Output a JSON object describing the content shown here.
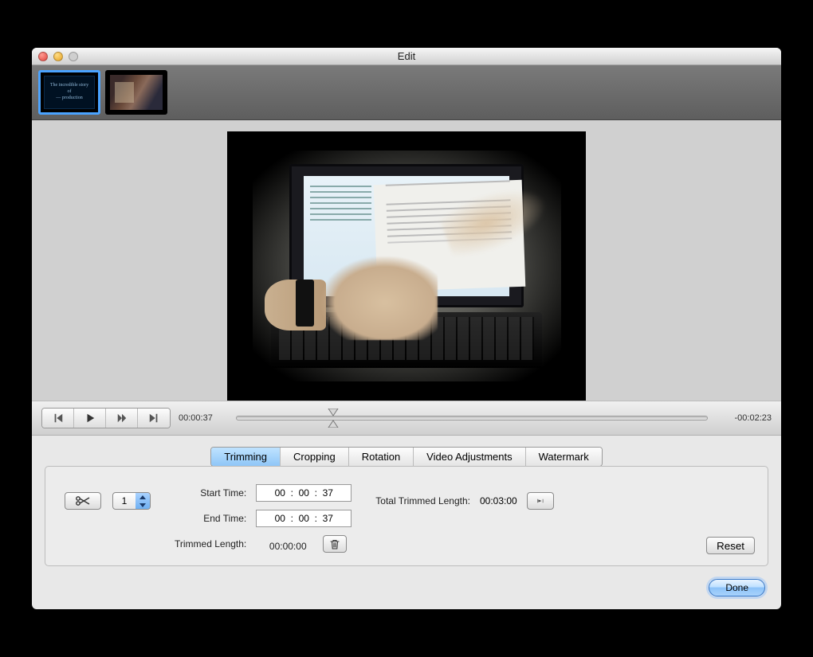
{
  "window": {
    "title": "Edit"
  },
  "thumbnails": [
    {
      "caption": "The incredible story of &mdash; production",
      "selected": true
    },
    {
      "caption": "",
      "selected": false
    }
  ],
  "playback": {
    "current_time": "00:00:37",
    "remaining_time": "-00:02:23",
    "position_percent": 20.6
  },
  "tabs": {
    "items": [
      "Trimming",
      "Cropping",
      "Rotation",
      "Video Adjustments",
      "Watermark"
    ],
    "active_index": 0
  },
  "trimming": {
    "segment_number": "1",
    "labels": {
      "start": "Start Time:",
      "end": "End Time:",
      "trimmed": "Trimmed Length:",
      "total": "Total Trimmed Length:"
    },
    "start_time": "00  :  00  :  37",
    "end_time": "00  :  00  :  37",
    "trimmed_length": "00:00:00",
    "total_trimmed_length": "00:03:00"
  },
  "buttons": {
    "reset": "Reset",
    "done": "Done"
  }
}
